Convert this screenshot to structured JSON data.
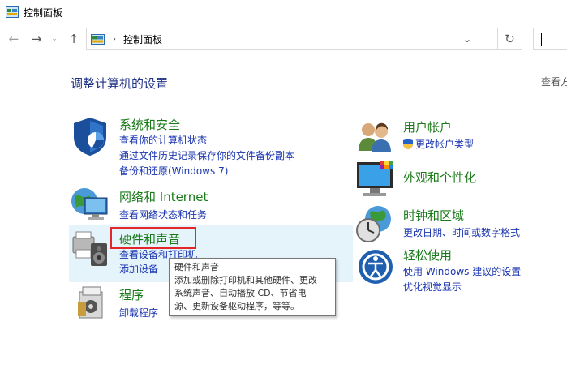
{
  "window": {
    "title": "控制面板"
  },
  "nav": {
    "back_icon": "back-arrow-icon",
    "forward_icon": "forward-arrow-icon",
    "up_icon": "up-arrow-icon",
    "breadcrumb": "控制面板",
    "refresh_icon": "refresh-icon"
  },
  "main": {
    "heading": "调整计算机的设置",
    "view_by": "查看方式"
  },
  "categories": {
    "system": {
      "title": "系统和安全",
      "links": [
        "查看你的计算机状态",
        "通过文件历史记录保存你的文件备份副本",
        "备份和还原(Windows 7)"
      ]
    },
    "network": {
      "title": "网络和 Internet",
      "links": [
        "查看网络状态和任务"
      ]
    },
    "hardware": {
      "title": "硬件和声音",
      "links": [
        "查看设备和打印机",
        "添加设备"
      ]
    },
    "programs": {
      "title": "程序",
      "links": [
        "卸载程序"
      ]
    },
    "users": {
      "title": "用户帐户",
      "links": [
        "更改帐户类型"
      ]
    },
    "appearance": {
      "title": "外观和个性化",
      "links": []
    },
    "clock": {
      "title": "时钟和区域",
      "links": [
        "更改日期、时间或数字格式"
      ]
    },
    "ease": {
      "title": "轻松使用",
      "links": [
        "使用 Windows 建议的设置",
        "优化视觉显示"
      ]
    }
  },
  "tooltip": {
    "lines": [
      "硬件和声音",
      "添加或删除打印机和其他硬件、更改",
      "系统声音、自动播放 CD、节省电",
      "源、更新设备驱动程序，等等。"
    ]
  },
  "colors": {
    "category_title": "#1a7a1a",
    "link": "#1a35b0",
    "heading": "#1e3287",
    "highlight": "#e5f3fb",
    "red_box": "#e3262a"
  }
}
